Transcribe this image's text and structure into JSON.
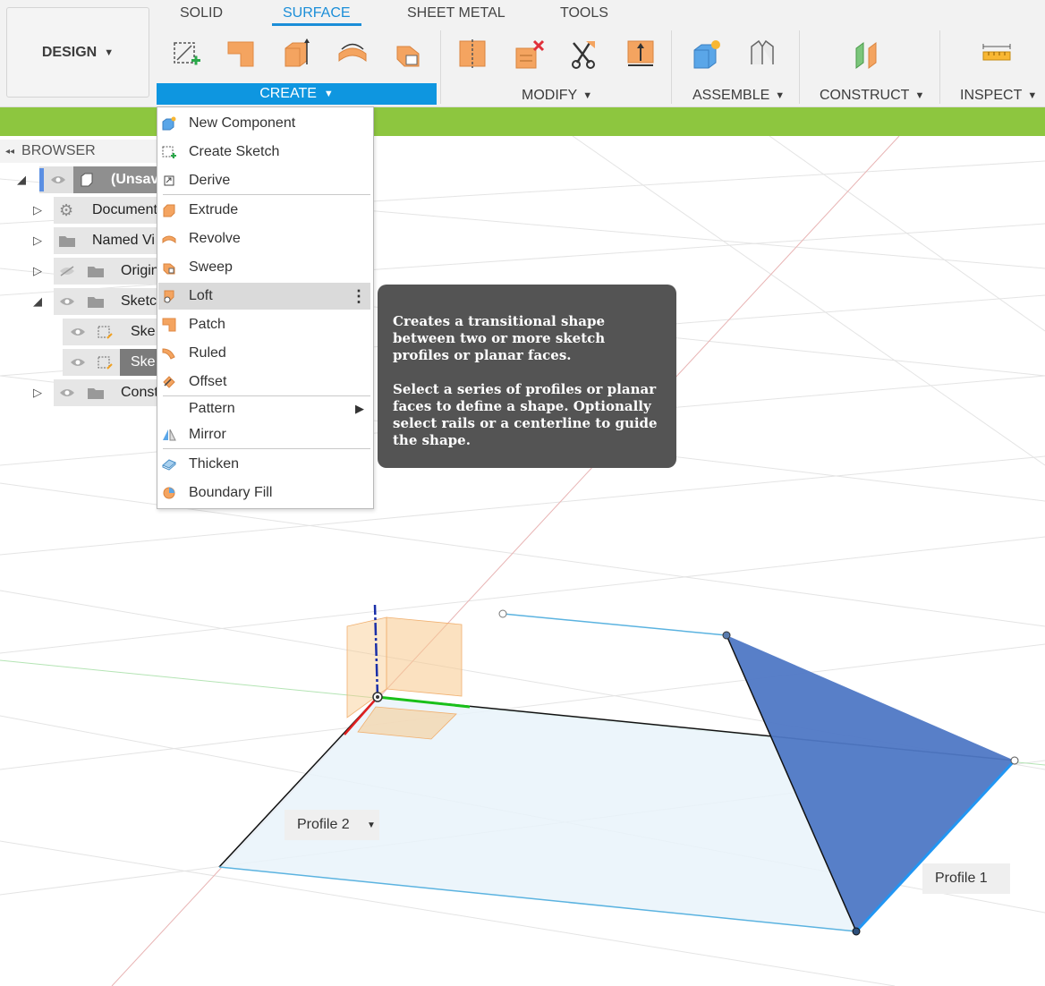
{
  "workspace": {
    "label": "DESIGN"
  },
  "tabs": [
    {
      "label": "SOLID"
    },
    {
      "label": "SURFACE"
    },
    {
      "label": "SHEET METAL"
    },
    {
      "label": "TOOLS"
    }
  ],
  "groups": {
    "create": "CREATE",
    "modify": "MODIFY",
    "assemble": "ASSEMBLE",
    "construct": "CONSTRUCT",
    "inspect": "INSPECT"
  },
  "browser": {
    "title": "BROWSER",
    "items": [
      {
        "label": "(Unsav"
      },
      {
        "label": "Document"
      },
      {
        "label": "Named Vi"
      },
      {
        "label": "Origin"
      },
      {
        "label": "Sketc"
      },
      {
        "label": "Ske"
      },
      {
        "label": "Ske"
      },
      {
        "label": "Const"
      }
    ]
  },
  "create_menu": {
    "items": [
      {
        "label": "New Component",
        "icon": "new-component-icon"
      },
      {
        "label": "Create Sketch",
        "icon": "create-sketch-icon"
      },
      {
        "label": "Derive",
        "icon": "derive-icon"
      },
      {
        "label": "Extrude",
        "icon": "extrude-icon"
      },
      {
        "label": "Revolve",
        "icon": "revolve-icon"
      },
      {
        "label": "Sweep",
        "icon": "sweep-icon"
      },
      {
        "label": "Loft",
        "icon": "loft-icon"
      },
      {
        "label": "Patch",
        "icon": "patch-icon"
      },
      {
        "label": "Ruled",
        "icon": "ruled-icon"
      },
      {
        "label": "Offset",
        "icon": "offset-icon"
      },
      {
        "label": "Pattern",
        "icon": "pattern-icon"
      },
      {
        "label": "Mirror",
        "icon": "mirror-icon"
      },
      {
        "label": "Thicken",
        "icon": "thicken-icon"
      },
      {
        "label": "Boundary Fill",
        "icon": "boundary-fill-icon"
      }
    ]
  },
  "tooltip": {
    "line1": "Creates a transitional shape between two or more sketch profiles or planar faces.",
    "line2": "Select a series of profiles or planar faces to define a shape. Optionally select rails or a centerline to guide the shape."
  },
  "canvas": {
    "profile2": "Profile 2",
    "profile1": "Profile 1"
  },
  "colors": {
    "accent": "#0e96e0",
    "green_bar": "#8dc63f",
    "triangle": "#4f78c5",
    "tooltip_bg": "#545454"
  }
}
